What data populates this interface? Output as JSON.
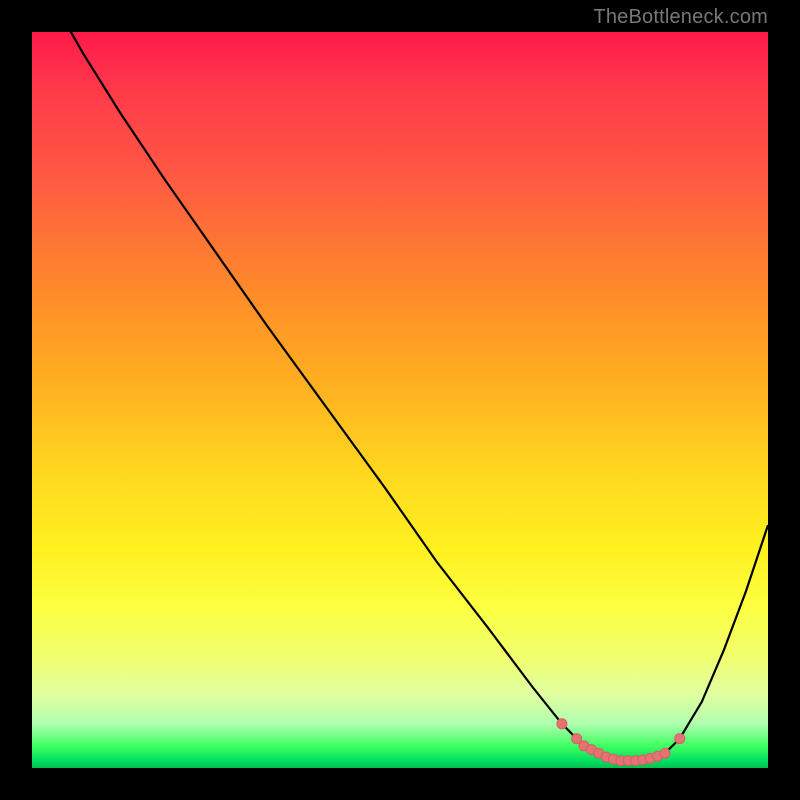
{
  "watermark": "TheBottleneck.com",
  "colors": {
    "curve": "#000000",
    "dot_fill": "#e57373",
    "dot_stroke": "#d46060"
  },
  "chart_data": {
    "type": "line",
    "title": "",
    "xlabel": "",
    "ylabel": "",
    "xlim": [
      0,
      100
    ],
    "ylim": [
      0,
      100
    ],
    "x": [
      0,
      3,
      7,
      12,
      18,
      25,
      32,
      40,
      48,
      55,
      62,
      68,
      72,
      74,
      76,
      78,
      80,
      82,
      84,
      86,
      88,
      91,
      94,
      97,
      100
    ],
    "values": [
      110,
      104,
      97,
      89,
      80,
      70,
      60,
      49,
      38,
      28,
      19,
      11,
      6,
      4,
      2.5,
      1.5,
      1,
      1,
      1.3,
      2,
      4,
      9,
      16,
      24,
      33
    ],
    "series": [
      {
        "name": "bottleneck-curve",
        "x": [
          0,
          3,
          7,
          12,
          18,
          25,
          32,
          40,
          48,
          55,
          62,
          68,
          72,
          74,
          76,
          78,
          80,
          82,
          84,
          86,
          88,
          91,
          94,
          97,
          100
        ],
        "y": [
          110,
          104,
          97,
          89,
          80,
          70,
          60,
          49,
          38,
          28,
          19,
          11,
          6,
          4,
          2.5,
          1.5,
          1,
          1,
          1.3,
          2,
          4,
          9,
          16,
          24,
          33
        ]
      }
    ],
    "optimal_zone_points": [
      {
        "x": 72,
        "y": 6
      },
      {
        "x": 74,
        "y": 4
      },
      {
        "x": 75,
        "y": 3
      },
      {
        "x": 76,
        "y": 2.5
      },
      {
        "x": 77,
        "y": 2
      },
      {
        "x": 78,
        "y": 1.5
      },
      {
        "x": 79,
        "y": 1.2
      },
      {
        "x": 80,
        "y": 1
      },
      {
        "x": 81,
        "y": 1
      },
      {
        "x": 82,
        "y": 1
      },
      {
        "x": 83,
        "y": 1.1
      },
      {
        "x": 84,
        "y": 1.3
      },
      {
        "x": 85,
        "y": 1.6
      },
      {
        "x": 86,
        "y": 2
      },
      {
        "x": 88,
        "y": 4
      }
    ],
    "grid": false,
    "legend": false
  }
}
